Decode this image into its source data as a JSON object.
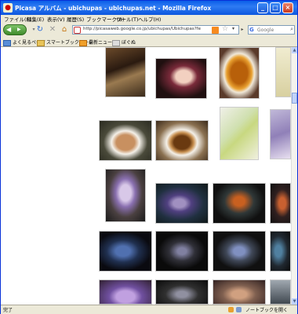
{
  "window": {
    "title": "Picasa アルバム - ubichupas - ubichupas.net - Mozilla Firefox",
    "icon": "firefox-icon"
  },
  "menu": [
    "ファイル(F)",
    "編集(E)",
    "表示(V)",
    "履歴(S)",
    "ブックマーク(B)",
    "ツール(T)",
    "ヘルプ(H)"
  ],
  "toolbar": {
    "url": "http://picasaweb.google.co.jp/ubichupas/Ubichupas?feat=authkey=Q",
    "search_placeholder": "Google",
    "search_logo": "G"
  },
  "bookmarks": [
    "よく見るページ",
    "スマートブックマーク",
    "最新ニュース",
    "ぼぐぬ"
  ],
  "status": {
    "left": "完了",
    "right": "ノートブックを開く"
  },
  "colors": {
    "title_bar": "#0a5ee8",
    "chrome": "#ece9d8",
    "page": "#ffffff"
  }
}
